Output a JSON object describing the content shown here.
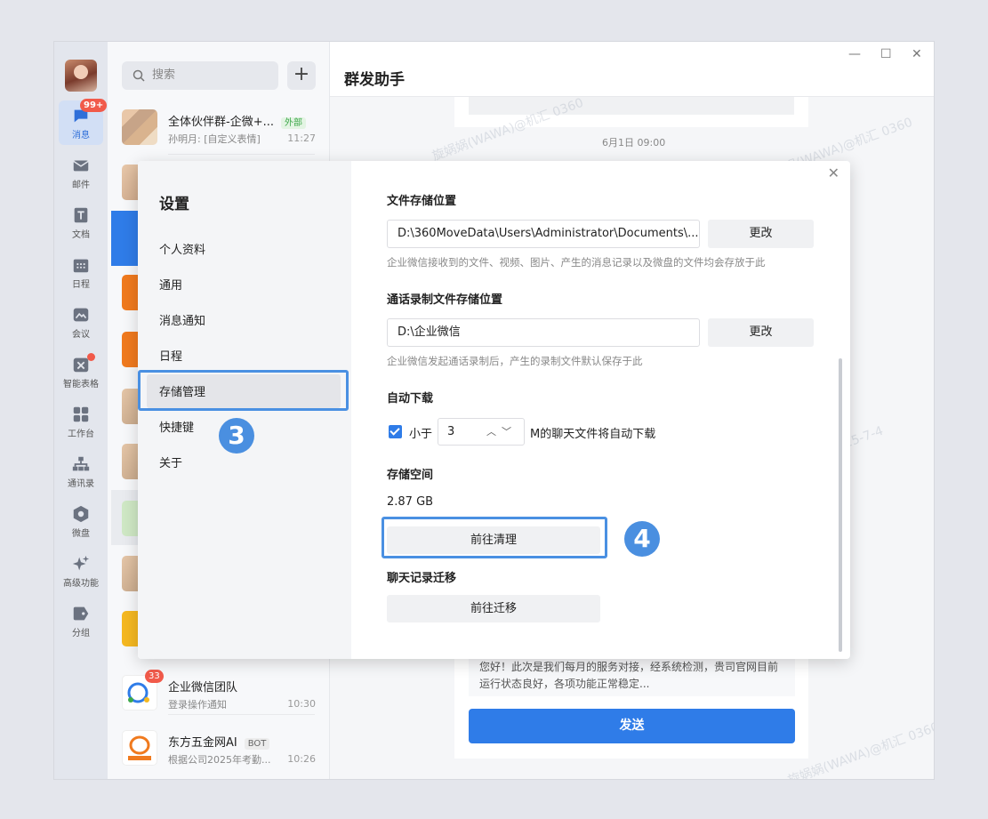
{
  "rail": {
    "items": [
      {
        "label": "消息",
        "badge": "99+"
      },
      {
        "label": "邮件"
      },
      {
        "label": "文档"
      },
      {
        "label": "日程"
      },
      {
        "label": "会议"
      },
      {
        "label": "智能表格"
      },
      {
        "label": "工作台"
      },
      {
        "label": "通讯录"
      },
      {
        "label": "微盘"
      },
      {
        "label": "高级功能"
      },
      {
        "label": "分组"
      }
    ]
  },
  "search": {
    "placeholder": "搜索"
  },
  "conversations": [
    {
      "name": "全体伙伴群-企微+...",
      "tag": "外部",
      "msg": "孙明月: [自定义表情]",
      "time": "11:27"
    },
    {
      "name": "企业微信团队",
      "badge": "33",
      "msg": "登录操作通知",
      "time": "10:30"
    },
    {
      "name": "东方五金网AI",
      "tag": "BOT",
      "msg": "根据公司2025年考勤...",
      "time": "10:26"
    }
  ],
  "chat": {
    "title": "群发助手",
    "time": "6月1日 09:00",
    "preview": "您好！此次是我们每月的服务对接，经系统检测，贵司官网目前运行状态良好，各项功能正常稳定...",
    "send_label": "发送",
    "watermark": "旋娲娲(WAWA)@机汇 0360",
    "watermark_date": "2025-7-4"
  },
  "window_controls": {
    "minimize": "—",
    "maximize": "☐",
    "close": "✕"
  },
  "settings": {
    "title": "设置",
    "nav": [
      "个人资料",
      "通用",
      "消息通知",
      "日程",
      "存储管理",
      "快捷键",
      "关于"
    ],
    "active_nav": "存储管理",
    "file_storage": {
      "title": "文件存储位置",
      "path": "D:\\360MoveData\\Users\\Administrator\\Documents\\...",
      "change_label": "更改",
      "hint": "企业微信接收到的文件、视频、图片、产生的消息记录以及微盘的文件均会存放于此"
    },
    "call_recording": {
      "title": "通话录制文件存储位置",
      "path": "D:\\企业微信",
      "change_label": "更改",
      "hint": "企业微信发起通话录制后，产生的录制文件默认保存于此"
    },
    "auto_download": {
      "title": "自动下载",
      "checked": true,
      "prefix": "小于",
      "value": "3",
      "suffix": "M的聊天文件将自动下载"
    },
    "storage_space": {
      "title": "存储空间",
      "size": "2.87 GB",
      "clean_label": "前往清理"
    },
    "migration": {
      "title": "聊天记录迁移",
      "migrate_label": "前往迁移"
    }
  },
  "annotations": {
    "step3": "3",
    "step4": "4",
    "color": "#4a90e2"
  }
}
